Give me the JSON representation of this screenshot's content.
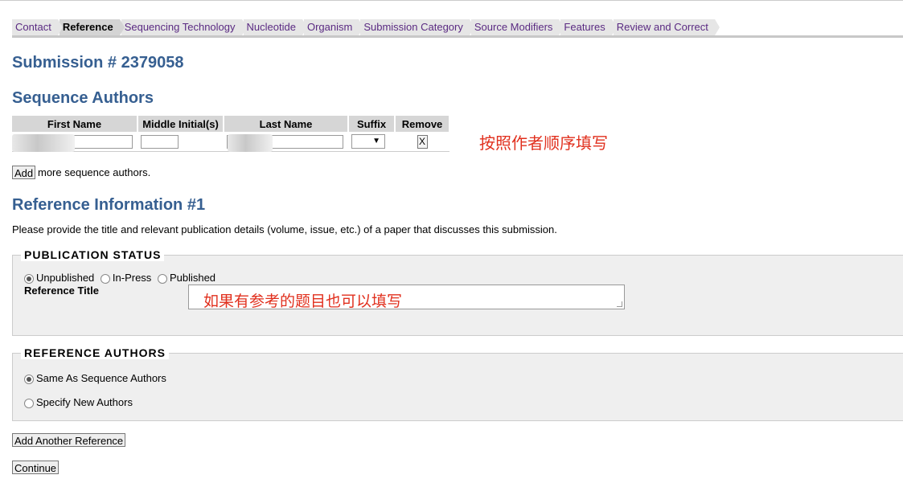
{
  "tabs": [
    {
      "label": "Contact",
      "active": false
    },
    {
      "label": "Reference",
      "active": true
    },
    {
      "label": "Sequencing Technology",
      "active": false
    },
    {
      "label": "Nucleotide",
      "active": false
    },
    {
      "label": "Organism",
      "active": false
    },
    {
      "label": "Submission Category",
      "active": false
    },
    {
      "label": "Source Modifiers",
      "active": false
    },
    {
      "label": "Features",
      "active": false
    },
    {
      "label": "Review and Correct",
      "active": false
    }
  ],
  "submission_title": "Submission # 2379058",
  "sequence_authors": {
    "title": "Sequence Authors",
    "columns": [
      "First Name",
      "Middle Initial(s)",
      "Last Name",
      "Suffix",
      "Remove"
    ],
    "remove_label": "X",
    "annotation": "按照作者顺序填写",
    "add_button": "Add",
    "add_text": "more sequence authors."
  },
  "reference": {
    "title": "Reference Information #1",
    "description": "Please provide the title and relevant publication details (volume, issue, etc.) of a paper that discusses this submission.",
    "publication_status": {
      "legend": "PUBLICATION  STATUS",
      "options": [
        "Unpublished",
        "In-Press",
        "Published"
      ],
      "selected": "Unpublished",
      "title_label": "Reference Title",
      "annotation": "如果有参考的题目也可以填写"
    },
    "reference_authors": {
      "legend": "REFERENCE  AUTHORS",
      "options": [
        "Same As Sequence Authors",
        "Specify New Authors"
      ],
      "selected": "Same As Sequence Authors"
    }
  },
  "buttons": {
    "add_reference": "Add Another Reference",
    "continue": "Continue"
  }
}
